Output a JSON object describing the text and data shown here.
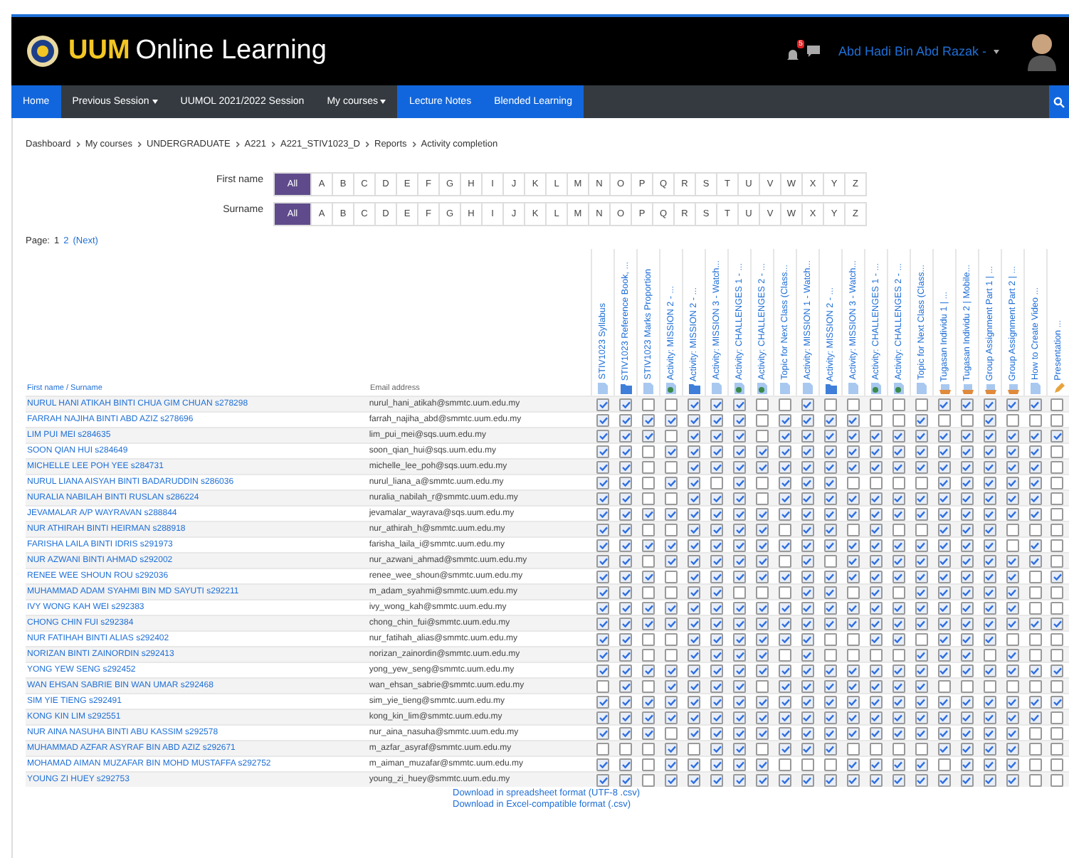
{
  "header": {
    "brand_short": "UUM",
    "brand_rest": "Online Learning",
    "notification_count": "5",
    "user_name": "Abd Hadi Bin Abd Razak -"
  },
  "nav": [
    {
      "label": "Home",
      "highlighted": true,
      "dropdown": false
    },
    {
      "label": "Previous Session",
      "highlighted": false,
      "dropdown": true
    },
    {
      "label": "UUMOL 2021/2022 Session",
      "highlighted": false,
      "dropdown": false
    },
    {
      "label": "My courses",
      "highlighted": false,
      "dropdown": true
    },
    {
      "label": "Lecture Notes",
      "highlighted": true,
      "dropdown": false
    },
    {
      "label": "Blended Learning",
      "highlighted": true,
      "dropdown": false
    }
  ],
  "breadcrumb": [
    "Dashboard",
    "My courses",
    "UNDERGRADUATE",
    "A221",
    "A221_STIV1023_D",
    "Reports",
    "Activity completion"
  ],
  "filters": [
    {
      "label": "First name",
      "letters": [
        {
          "label": "All",
          "selected": true
        },
        {
          "label": "A",
          "selected": false
        },
        {
          "label": "B",
          "selected": false
        },
        {
          "label": "C",
          "selected": false
        },
        {
          "label": "D",
          "selected": false
        },
        {
          "label": "E",
          "selected": false
        },
        {
          "label": "F",
          "selected": false
        },
        {
          "label": "G",
          "selected": false
        },
        {
          "label": "H",
          "selected": false
        },
        {
          "label": "I",
          "selected": false
        },
        {
          "label": "J",
          "selected": false
        },
        {
          "label": "K",
          "selected": false
        },
        {
          "label": "L",
          "selected": false
        },
        {
          "label": "M",
          "selected": false
        },
        {
          "label": "N",
          "selected": false
        },
        {
          "label": "O",
          "selected": false
        },
        {
          "label": "P",
          "selected": false
        },
        {
          "label": "Q",
          "selected": false
        },
        {
          "label": "R",
          "selected": false
        },
        {
          "label": "S",
          "selected": false
        },
        {
          "label": "T",
          "selected": false
        },
        {
          "label": "U",
          "selected": false
        },
        {
          "label": "V",
          "selected": false
        },
        {
          "label": "W",
          "selected": false
        },
        {
          "label": "X",
          "selected": false
        },
        {
          "label": "Y",
          "selected": false
        },
        {
          "label": "Z",
          "selected": false
        }
      ]
    },
    {
      "label": "Surname",
      "letters": [
        {
          "label": "All",
          "selected": true
        },
        {
          "label": "A",
          "selected": false
        },
        {
          "label": "B",
          "selected": false
        },
        {
          "label": "C",
          "selected": false
        },
        {
          "label": "D",
          "selected": false
        },
        {
          "label": "E",
          "selected": false
        },
        {
          "label": "F",
          "selected": false
        },
        {
          "label": "G",
          "selected": false
        },
        {
          "label": "H",
          "selected": false
        },
        {
          "label": "I",
          "selected": false
        },
        {
          "label": "J",
          "selected": false
        },
        {
          "label": "K",
          "selected": false
        },
        {
          "label": "L",
          "selected": false
        },
        {
          "label": "M",
          "selected": false
        },
        {
          "label": "N",
          "selected": false
        },
        {
          "label": "O",
          "selected": false
        },
        {
          "label": "P",
          "selected": false
        },
        {
          "label": "Q",
          "selected": false
        },
        {
          "label": "R",
          "selected": false
        },
        {
          "label": "S",
          "selected": false
        },
        {
          "label": "T",
          "selected": false
        },
        {
          "label": "U",
          "selected": false
        },
        {
          "label": "V",
          "selected": false
        },
        {
          "label": "W",
          "selected": false
        },
        {
          "label": "X",
          "selected": false
        },
        {
          "label": "Y",
          "selected": false
        },
        {
          "label": "Z",
          "selected": false
        }
      ]
    }
  ],
  "pagination": {
    "label": "Page:",
    "pages": [
      {
        "label": "1",
        "selected": true
      },
      {
        "label": "2",
        "selected": false
      }
    ],
    "next": "(Next)"
  },
  "table": {
    "name_header": "First name / Surname",
    "email_header": "Email address",
    "activities": [
      {
        "title": "STIV1023 Syllabus",
        "kind": "file"
      },
      {
        "title": "STIV1023 Reference Book, ...",
        "kind": "folder"
      },
      {
        "title": "STIV1023 Marks Proportion",
        "kind": "file"
      },
      {
        "title": "Activity: MISSION 2 - ...",
        "kind": "interactive"
      },
      {
        "title": "Activity: MISSION 2 - ...",
        "kind": "folder"
      },
      {
        "title": "Activity: MISSION 3 - Watch...",
        "kind": "file"
      },
      {
        "title": "Activity: CHALLENGES 1 - ...",
        "kind": "interactive"
      },
      {
        "title": "Activity: CHALLENGES 2 - ...",
        "kind": "interactive"
      },
      {
        "title": "Topic for Next Class (Class...",
        "kind": "file"
      },
      {
        "title": "Activity: MISSION 1 - Watch...",
        "kind": "file"
      },
      {
        "title": "Activity: MISSION 2 - ...",
        "kind": "folder"
      },
      {
        "title": "Activity: MISSION 3 - Watch...",
        "kind": "file"
      },
      {
        "title": "Activity: CHALLENGES 1 - ...",
        "kind": "interactive"
      },
      {
        "title": "Activity: CHALLENGES 2 - ...",
        "kind": "interactive"
      },
      {
        "title": "Topic for Next Class (Class...",
        "kind": "file"
      },
      {
        "title": "Tugasan Individu 1 | ...",
        "kind": "assignment"
      },
      {
        "title": "Tugasan Individu 2 | Mobile...",
        "kind": "assignment"
      },
      {
        "title": "Group Assignment Part 1 | ...",
        "kind": "assignment"
      },
      {
        "title": "Group Assignment Part 2 | ...",
        "kind": "assignment"
      },
      {
        "title": "How to Create Video ...",
        "kind": "file"
      },
      {
        "title": "Presentation ...",
        "kind": "pencil"
      }
    ],
    "rows": [
      {
        "name": "NURUL HANI ATIKAH BINTI CHUA GIM CHUAN s278298",
        "email": "nurul_hani_atikah@smmtc.uum.edu.my",
        "completion": [
          true,
          true,
          false,
          false,
          true,
          true,
          true,
          false,
          false,
          true,
          false,
          false,
          false,
          false,
          false,
          true,
          true,
          true,
          true,
          true,
          false
        ]
      },
      {
        "name": "FARRAH NAJIHA BINTI ABD AZIZ s278696",
        "email": "farrah_najiha_abd@smmtc.uum.edu.my",
        "completion": [
          true,
          true,
          true,
          true,
          true,
          true,
          true,
          false,
          true,
          true,
          true,
          true,
          false,
          false,
          true,
          false,
          false,
          true,
          false,
          false,
          false
        ]
      },
      {
        "name": "LIM PUI MEI s284635",
        "email": "lim_pui_mei@sqs.uum.edu.my",
        "completion": [
          true,
          true,
          true,
          false,
          true,
          true,
          true,
          false,
          true,
          true,
          true,
          true,
          true,
          true,
          true,
          true,
          true,
          true,
          true,
          true,
          true
        ]
      },
      {
        "name": "SOON QIAN HUI s284649",
        "email": "soon_qian_hui@sqs.uum.edu.my",
        "completion": [
          true,
          true,
          false,
          true,
          true,
          true,
          true,
          true,
          true,
          true,
          true,
          true,
          true,
          true,
          true,
          true,
          true,
          true,
          true,
          true,
          false
        ]
      },
      {
        "name": "MICHELLE LEE POH YEE s284731",
        "email": "michelle_lee_poh@sqs.uum.edu.my",
        "completion": [
          true,
          true,
          false,
          false,
          true,
          true,
          true,
          true,
          true,
          true,
          true,
          true,
          true,
          true,
          true,
          true,
          true,
          true,
          true,
          true,
          false
        ]
      },
      {
        "name": "NURUL LIANA AISYAH BINTI BADARUDDIN s286036",
        "email": "nurul_liana_a@smmtc.uum.edu.my",
        "completion": [
          true,
          true,
          false,
          true,
          true,
          false,
          true,
          false,
          true,
          true,
          true,
          false,
          false,
          false,
          false,
          true,
          true,
          true,
          true,
          true,
          false
        ]
      },
      {
        "name": "NURALIA NABILAH BINTI RUSLAN s286224",
        "email": "nuralia_nabilah_r@smmtc.uum.edu.my",
        "completion": [
          true,
          true,
          false,
          false,
          true,
          true,
          true,
          false,
          true,
          true,
          true,
          true,
          true,
          true,
          true,
          true,
          true,
          true,
          true,
          true,
          false
        ]
      },
      {
        "name": "JEVAMALAR A/P WAYRAVAN s288844",
        "email": "jevamalar_wayrava@sqs.uum.edu.my",
        "completion": [
          true,
          true,
          true,
          true,
          true,
          true,
          true,
          true,
          true,
          true,
          true,
          true,
          true,
          true,
          true,
          true,
          true,
          true,
          true,
          true,
          false
        ]
      },
      {
        "name": "NUR ATHIRAH BINTI HEIRMAN s288918",
        "email": "nur_athirah_h@smmtc.uum.edu.my",
        "completion": [
          true,
          true,
          false,
          false,
          true,
          true,
          true,
          true,
          false,
          true,
          true,
          false,
          true,
          false,
          false,
          true,
          true,
          true,
          false,
          false,
          false
        ]
      },
      {
        "name": "FARISHA LAILA BINTI IDRIS s291973",
        "email": "farisha_laila_i@smmtc.uum.edu.my",
        "completion": [
          true,
          true,
          true,
          true,
          true,
          true,
          true,
          true,
          true,
          true,
          true,
          true,
          true,
          true,
          true,
          true,
          true,
          true,
          false,
          true,
          false
        ]
      },
      {
        "name": "NUR AZWANI BINTI AHMAD s292002",
        "email": "nur_azwani_ahmad@smmtc.uum.edu.my",
        "completion": [
          true,
          true,
          false,
          true,
          true,
          true,
          true,
          true,
          false,
          true,
          false,
          true,
          true,
          true,
          true,
          true,
          true,
          true,
          true,
          true,
          false
        ]
      },
      {
        "name": "RENEE WEE SHOUN ROU s292036",
        "email": "renee_wee_shoun@smmtc.uum.edu.my",
        "completion": [
          true,
          true,
          true,
          false,
          true,
          true,
          true,
          true,
          true,
          true,
          true,
          true,
          true,
          true,
          true,
          true,
          true,
          true,
          true,
          false,
          true
        ]
      },
      {
        "name": "MUHAMMAD ADAM SYAHMI BIN MD SAYUTI s292211",
        "email": "m_adam_syahmi@smmtc.uum.edu.my",
        "completion": [
          true,
          true,
          false,
          false,
          true,
          true,
          false,
          false,
          false,
          true,
          true,
          false,
          true,
          false,
          true,
          true,
          true,
          true,
          true,
          false,
          false
        ]
      },
      {
        "name": "IVY WONG KAH WEI s292383",
        "email": "ivy_wong_kah@smmtc.uum.edu.my",
        "completion": [
          true,
          true,
          true,
          true,
          true,
          true,
          true,
          true,
          true,
          true,
          true,
          true,
          true,
          true,
          true,
          true,
          true,
          true,
          true,
          false,
          false
        ]
      },
      {
        "name": "CHONG CHIN FUI s292384",
        "email": "chong_chin_fui@smmtc.uum.edu.my",
        "completion": [
          true,
          true,
          true,
          true,
          true,
          true,
          true,
          true,
          true,
          true,
          true,
          true,
          true,
          true,
          true,
          true,
          true,
          true,
          true,
          true,
          true
        ]
      },
      {
        "name": "NUR FATIHAH BINTI ALIAS s292402",
        "email": "nur_fatihah_alias@smmtc.uum.edu.my",
        "completion": [
          true,
          true,
          false,
          false,
          true,
          true,
          true,
          true,
          true,
          true,
          false,
          false,
          true,
          true,
          false,
          true,
          true,
          true,
          false,
          false,
          false
        ]
      },
      {
        "name": "NORIZAN BINTI ZAINORDIN s292413",
        "email": "norizan_zainordin@smmtc.uum.edu.my",
        "completion": [
          true,
          true,
          false,
          false,
          true,
          true,
          true,
          true,
          false,
          true,
          false,
          false,
          false,
          false,
          true,
          true,
          true,
          false,
          true,
          false,
          false
        ]
      },
      {
        "name": "YONG YEW SENG s292452",
        "email": "yong_yew_seng@smmtc.uum.edu.my",
        "completion": [
          true,
          true,
          true,
          true,
          true,
          true,
          true,
          true,
          true,
          true,
          true,
          true,
          true,
          true,
          true,
          true,
          true,
          true,
          true,
          true,
          true
        ]
      },
      {
        "name": "WAN EHSAN SABRIE BIN WAN UMAR s292468",
        "email": "wan_ehsan_sabrie@smmtc.uum.edu.my",
        "completion": [
          false,
          true,
          false,
          true,
          true,
          true,
          true,
          false,
          true,
          true,
          true,
          true,
          true,
          true,
          true,
          false,
          false,
          false,
          false,
          false,
          false
        ]
      },
      {
        "name": "SIM YIE TIENG s292491",
        "email": "sim_yie_tieng@smmtc.uum.edu.my",
        "completion": [
          true,
          true,
          true,
          true,
          true,
          true,
          true,
          true,
          true,
          true,
          true,
          true,
          true,
          true,
          true,
          true,
          true,
          true,
          true,
          true,
          true
        ]
      },
      {
        "name": "KONG KIN LIM s292551",
        "email": "kong_kin_lim@smmtc.uum.edu.my",
        "completion": [
          true,
          true,
          true,
          true,
          true,
          true,
          true,
          true,
          true,
          true,
          true,
          true,
          true,
          true,
          true,
          true,
          true,
          true,
          true,
          true,
          false
        ]
      },
      {
        "name": "NUR AINA NASUHA BINTI ABU KASSIM s292578",
        "email": "nur_aina_nasuha@smmtc.uum.edu.my",
        "completion": [
          true,
          true,
          true,
          false,
          true,
          true,
          true,
          true,
          true,
          true,
          true,
          true,
          true,
          true,
          true,
          true,
          true,
          true,
          true,
          false,
          false
        ]
      },
      {
        "name": "MUHAMMAD AZFAR ASYRAF BIN ABD AZIZ s292671",
        "email": "m_azfar_asyraf@smmtc.uum.edu.my",
        "completion": [
          false,
          false,
          false,
          true,
          false,
          true,
          true,
          false,
          true,
          true,
          true,
          false,
          false,
          false,
          false,
          true,
          true,
          true,
          true,
          false,
          false
        ]
      },
      {
        "name": "MOHAMAD AIMAN MUZAFAR BIN MOHD MUSTAFFA s292752",
        "email": "m_aiman_muzafar@smmtc.uum.edu.my",
        "completion": [
          true,
          true,
          false,
          true,
          true,
          true,
          true,
          true,
          false,
          false,
          false,
          true,
          true,
          true,
          true,
          false,
          true,
          true,
          true,
          false,
          false
        ]
      },
      {
        "name": "YOUNG ZI HUEY s292753",
        "email": "young_zi_huey@smmtc.uum.edu.my",
        "completion": [
          true,
          true,
          false,
          true,
          true,
          true,
          true,
          true,
          true,
          true,
          true,
          true,
          true,
          true,
          true,
          true,
          true,
          true,
          true,
          false,
          false
        ]
      }
    ]
  },
  "downloads": [
    "Download in spreadsheet format (UTF-8 .csv)",
    "Download in Excel-compatible format (.csv)"
  ]
}
